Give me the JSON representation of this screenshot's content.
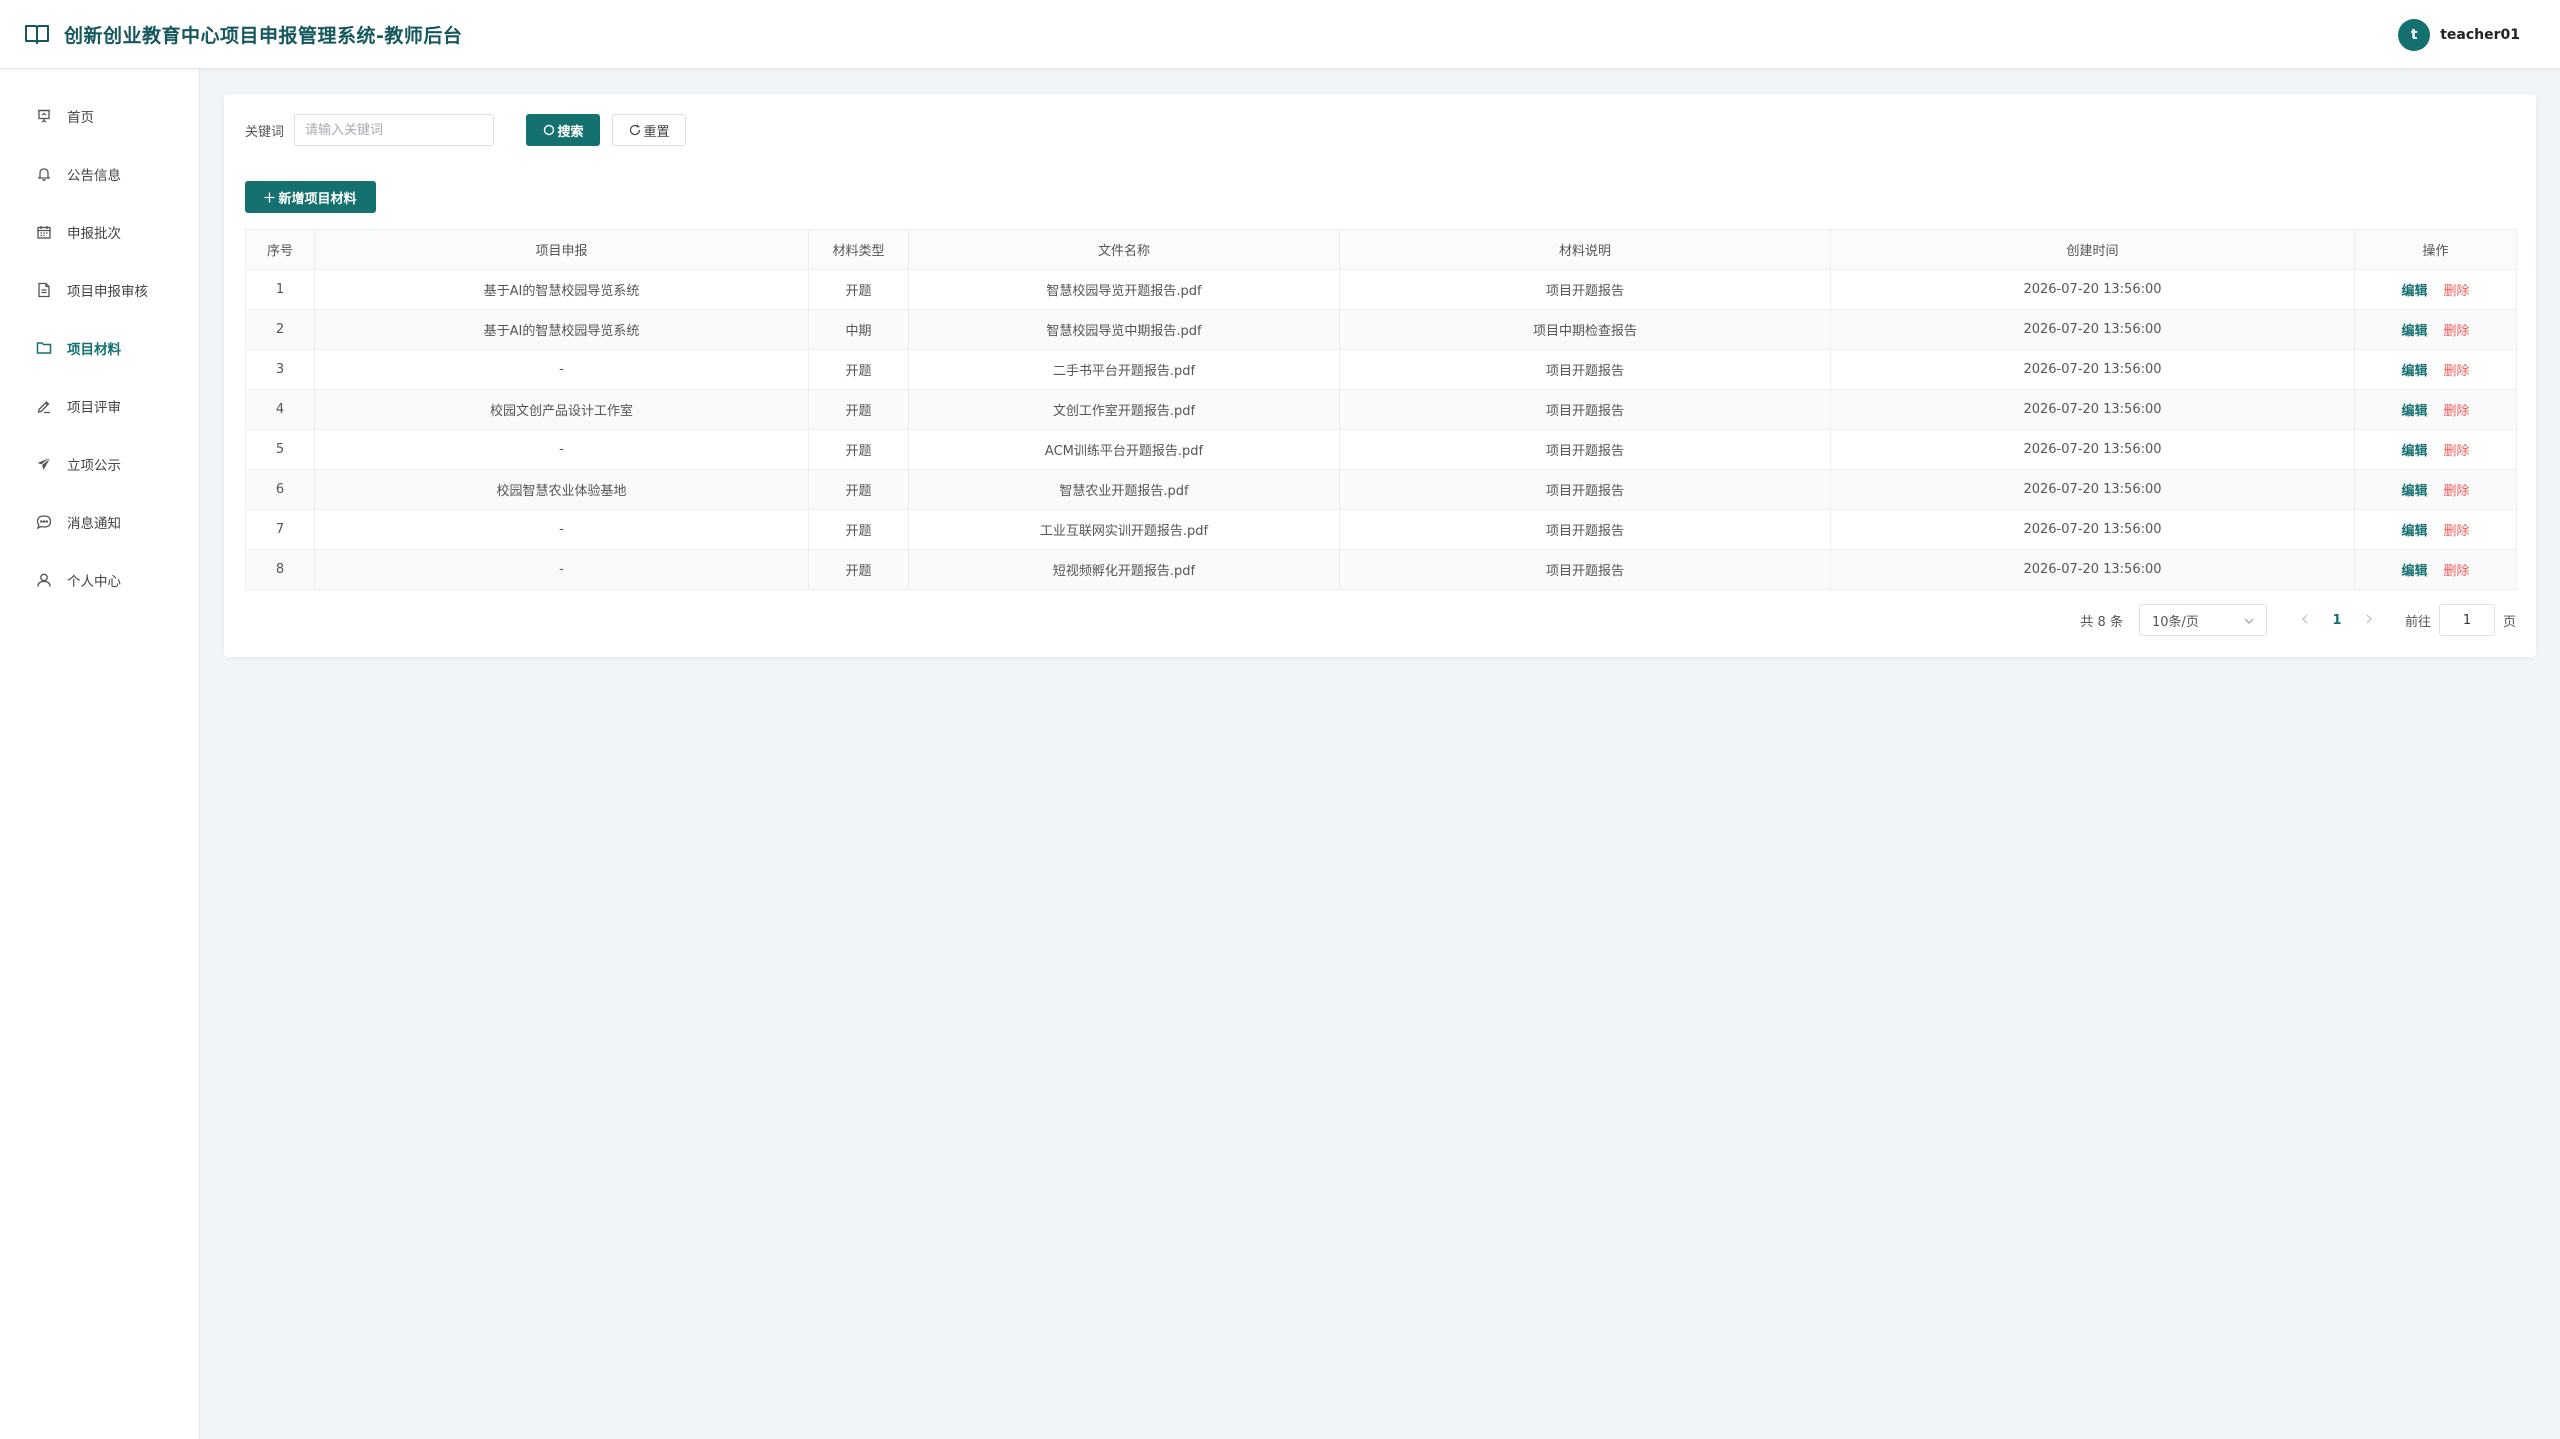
{
  "header": {
    "title": "创新创业教育中心项目申报管理系统-教师后台"
  },
  "user": {
    "avatar_letter": "t",
    "name": "teacher01"
  },
  "sidebar": {
    "items": [
      {
        "label": "首页",
        "icon": "presentation-board-icon",
        "active": false
      },
      {
        "label": "公告信息",
        "icon": "bell-icon",
        "active": false
      },
      {
        "label": "申报批次",
        "icon": "calendar-icon",
        "active": false
      },
      {
        "label": "项目申报审核",
        "icon": "document-icon",
        "active": false
      },
      {
        "label": "项目材料",
        "icon": "folder-icon",
        "active": true
      },
      {
        "label": "项目评审",
        "icon": "pen-icon",
        "active": false
      },
      {
        "label": "立项公示",
        "icon": "send-icon",
        "active": false
      },
      {
        "label": "消息通知",
        "icon": "chat-bubble-icon",
        "active": false
      },
      {
        "label": "个人中心",
        "icon": "user-icon",
        "active": false
      }
    ]
  },
  "search": {
    "label": "关键词",
    "placeholder": "请输入关键词",
    "value": "",
    "search_label": "搜索",
    "reset_label": "重置"
  },
  "toolbar": {
    "add_label": "新增项目材料"
  },
  "table": {
    "columns": [
      "序号",
      "项目申报",
      "材料类型",
      "文件名称",
      "材料说明",
      "创建时间",
      "操作"
    ],
    "edit_label": "编辑",
    "delete_label": "删除",
    "rows": [
      {
        "no": "1",
        "project": "基于AI的智慧校园导览系统",
        "type": "开题",
        "file": "智慧校园导览开题报告.pdf",
        "desc": "项目开题报告",
        "created": "2026-07-20 13:56:00"
      },
      {
        "no": "2",
        "project": "基于AI的智慧校园导览系统",
        "type": "中期",
        "file": "智慧校园导览中期报告.pdf",
        "desc": "项目中期检查报告",
        "created": "2026-07-20 13:56:00"
      },
      {
        "no": "3",
        "project": "-",
        "type": "开题",
        "file": "二手书平台开题报告.pdf",
        "desc": "项目开题报告",
        "created": "2026-07-20 13:56:00"
      },
      {
        "no": "4",
        "project": "校园文创产品设计工作室",
        "type": "开题",
        "file": "文创工作室开题报告.pdf",
        "desc": "项目开题报告",
        "created": "2026-07-20 13:56:00"
      },
      {
        "no": "5",
        "project": "-",
        "type": "开题",
        "file": "ACM训练平台开题报告.pdf",
        "desc": "项目开题报告",
        "created": "2026-07-20 13:56:00"
      },
      {
        "no": "6",
        "project": "校园智慧农业体验基地",
        "type": "开题",
        "file": "智慧农业开题报告.pdf",
        "desc": "项目开题报告",
        "created": "2026-07-20 13:56:00"
      },
      {
        "no": "7",
        "project": "-",
        "type": "开题",
        "file": "工业互联网实训开题报告.pdf",
        "desc": "项目开题报告",
        "created": "2026-07-20 13:56:00"
      },
      {
        "no": "8",
        "project": "-",
        "type": "开题",
        "file": "短视频孵化开题报告.pdf",
        "desc": "项目开题报告",
        "created": "2026-07-20 13:56:00"
      }
    ]
  },
  "pagination": {
    "total_text": "共 8 条",
    "page_size": "10条/页",
    "current_page": "1",
    "goto_label": "前往",
    "goto_value": "1",
    "goto_suffix": "页"
  },
  "colors": {
    "primary": "#14716f",
    "danger": "#f25c5c",
    "background": "#f1f5f7"
  }
}
